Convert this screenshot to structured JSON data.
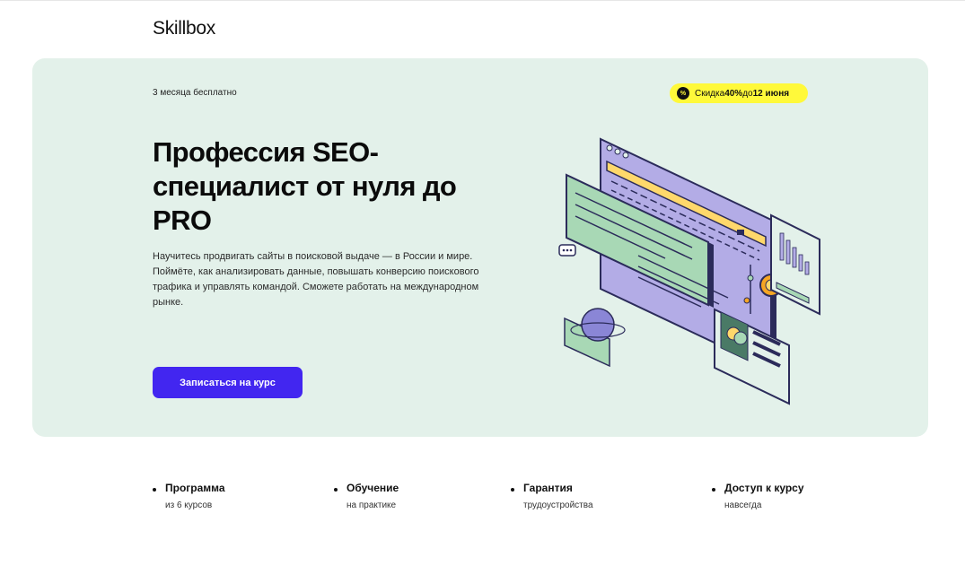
{
  "header": {
    "logo": "Skillbox"
  },
  "hero": {
    "eyebrow": "3 месяца бесплатно",
    "badge": {
      "icon": "percent-icon",
      "prefix": "Скидка ",
      "discount": "40%",
      "middle": " до ",
      "date": "12 июня"
    },
    "title": "Профессия SEO-специалист от нуля до PRO",
    "lead": "Научитесь продвигать сайты в поисковой выдаче — в России и мире. Поймёте, как анализировать данные, повышать конверсию поискового трафика и управлять командой. Сможете работать на международном рынке.",
    "cta_label": "Записаться на курс"
  },
  "features": [
    {
      "title": "Программа",
      "subtitle": "из 6 курсов"
    },
    {
      "title": "Обучение",
      "subtitle": "на практике"
    },
    {
      "title": "Гарантия",
      "subtitle": "трудоустройства"
    },
    {
      "title": "Доступ к курсу",
      "subtitle": "навсегда"
    }
  ],
  "colors": {
    "hero_bg": "#e3f1ea",
    "badge_bg": "#fff93a",
    "cta_bg": "#4226f0",
    "illus_purple": "#b3ace6",
    "illus_green": "#a8d8b5",
    "illus_yellow": "#ffd86b",
    "illus_orange": "#f6a623"
  }
}
